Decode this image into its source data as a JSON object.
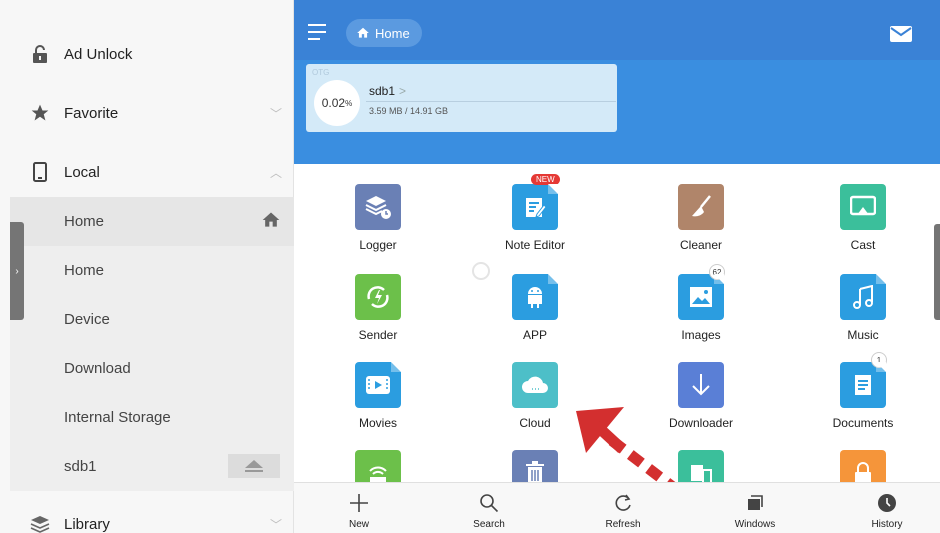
{
  "sidebar": {
    "items": [
      {
        "label": "Ad Unlock",
        "icon": "unlock-icon"
      },
      {
        "label": "Favorite",
        "icon": "star-icon",
        "chevron": "﹀"
      },
      {
        "label": "Local",
        "icon": "phone-icon",
        "chevron": "︿"
      }
    ],
    "local_children": [
      "Home",
      "Home",
      "Device",
      "Download",
      "Internal Storage",
      "sdb1"
    ],
    "library": {
      "label": "Library",
      "icon": "layers-icon",
      "chevron": "﹀"
    },
    "drawer_tab_glyph": "›"
  },
  "header": {
    "breadcrumb": "Home",
    "mail_icon": "mail-icon",
    "accent": "#3a82d6"
  },
  "storage": {
    "tag": "OTG",
    "name": "sdb1",
    "chevron": ">",
    "percent": "0.02",
    "percent_unit": "%",
    "size": "3.59 MB / 14.91 GB"
  },
  "apps": [
    {
      "label": "Logger",
      "color": "#6a80b5",
      "icon": "logger-icon"
    },
    {
      "label": "Note Editor",
      "color": "#2b9de0",
      "icon": "note-editor-icon",
      "badge": "NEW"
    },
    {
      "label": "Cleaner",
      "color": "#b0856a",
      "icon": "broom-icon"
    },
    {
      "label": "Cast",
      "color": "#3bbf9b",
      "icon": "cast-icon"
    },
    {
      "label": "Sender",
      "color": "#6cc04a",
      "icon": "sender-icon"
    },
    {
      "label": "APP",
      "color": "#2b9de0",
      "icon": "android-icon"
    },
    {
      "label": "Images",
      "color": "#2b9de0",
      "icon": "image-icon",
      "badge": "62"
    },
    {
      "label": "Music",
      "color": "#2b9de0",
      "icon": "music-icon"
    },
    {
      "label": "Movies",
      "color": "#2b9de0",
      "icon": "movie-icon"
    },
    {
      "label": "Cloud",
      "color": "#4dbfc8",
      "icon": "cloud-icon"
    },
    {
      "label": "Downloader",
      "color": "#5a7fd6",
      "icon": "download-icon"
    },
    {
      "label": "Documents",
      "color": "#2b9de0",
      "icon": "document-icon",
      "badge": "1"
    }
  ],
  "toolbar": [
    {
      "label": "New",
      "icon": "plus-icon"
    },
    {
      "label": "Search",
      "icon": "search-icon"
    },
    {
      "label": "Refresh",
      "icon": "refresh-icon"
    },
    {
      "label": "Windows",
      "icon": "windows-icon"
    },
    {
      "label": "History",
      "icon": "history-icon"
    }
  ],
  "annotation_color": "#d32f2f"
}
